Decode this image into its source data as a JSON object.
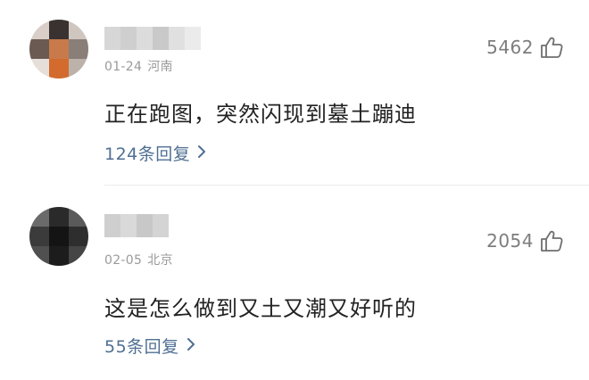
{
  "comments": [
    {
      "date": "01-24",
      "location": "河南",
      "likes": "5462",
      "text": "正在跑图，突然闪现到墓土蹦迪",
      "replies": "124条回复"
    },
    {
      "date": "02-05",
      "location": "北京",
      "likes": "2054",
      "text": "这是怎么做到又土又潮又好听的",
      "replies": "55条回复"
    }
  ],
  "icons": {
    "like": "thumbs-up-icon",
    "reply_arrow": "chevron-right-icon"
  },
  "colors": {
    "reply_link": "#4f6f93",
    "meta_text": "#9a9a9a",
    "like_count": "#7d7d7d",
    "body_text": "#222222"
  }
}
